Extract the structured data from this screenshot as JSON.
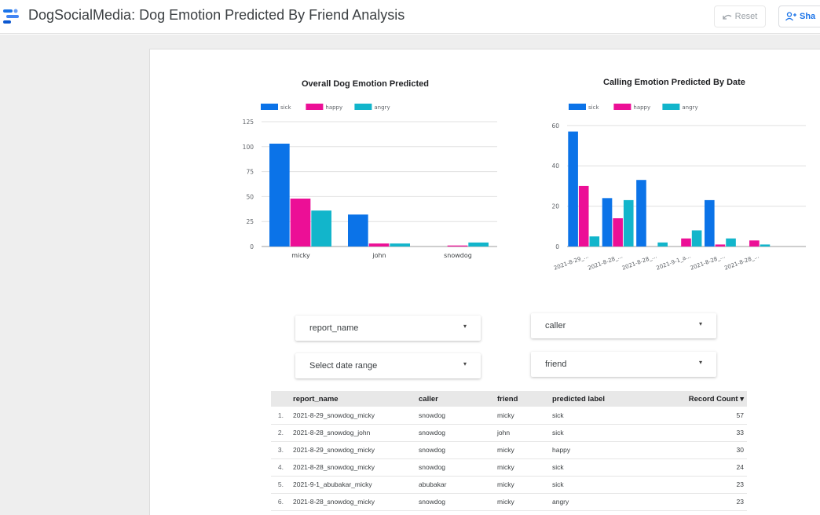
{
  "header": {
    "title": "DogSocialMedia: Dog Emotion Predicted By Friend Analysis",
    "reset_label": "Reset",
    "share_label": "Sha",
    "logo_icon": "looker-studio-logo-icon",
    "reset_icon": "reset-arrow-icon",
    "share_icon": "add-person-icon"
  },
  "colors": {
    "sick": "#0b73e8",
    "happy": "#ec0f96",
    "angry": "#12b5cb",
    "accent": "#1a73e8"
  },
  "chart_data": [
    {
      "type": "bar",
      "title": "Overall Dog Emotion Predicted",
      "categories": [
        "micky",
        "john",
        "snowdog"
      ],
      "series": [
        {
          "name": "sick",
          "values": [
            103,
            32,
            0
          ]
        },
        {
          "name": "happy",
          "values": [
            48,
            3,
            1
          ]
        },
        {
          "name": "angry",
          "values": [
            36,
            3,
            4
          ]
        }
      ],
      "yticks": [
        "0",
        "25",
        "50",
        "75",
        "100",
        "125"
      ],
      "ylim": [
        0,
        125
      ],
      "legend": "top-left",
      "grid": true
    },
    {
      "type": "bar",
      "title": "Calling Emotion Predicted By Date",
      "categories": [
        "2021-8-29_...",
        "2021-8-28_...",
        "2021-8-28_...",
        "2021-9-1_a...",
        "2021-8-28_...",
        "2021-8-28_..."
      ],
      "series": [
        {
          "name": "sick",
          "values": [
            57,
            24,
            33,
            0,
            23,
            0,
            0
          ]
        },
        {
          "name": "happy",
          "values": [
            30,
            14,
            0,
            4,
            1,
            3,
            0
          ]
        },
        {
          "name": "angry",
          "values": [
            5,
            23,
            2,
            8,
            4,
            1,
            0
          ]
        }
      ],
      "yticks": [
        "0",
        "20",
        "40",
        "60"
      ],
      "ylim": [
        0,
        65
      ],
      "legend": "top-left",
      "grid": true
    }
  ],
  "filters": {
    "report_name": "report_name",
    "caller": "caller",
    "date_range": "Select date range",
    "friend": "friend",
    "dropdown_icon": "caret-down-icon"
  },
  "table": {
    "headers": [
      "report_name",
      "caller",
      "friend",
      "predicted label",
      "Record Count"
    ],
    "sort_indicator": "▾",
    "rows": [
      {
        "idx": "1.",
        "report_name": "2021-8-29_snowdog_micky",
        "caller": "snowdog",
        "friend": "micky",
        "label": "sick",
        "count": "57"
      },
      {
        "idx": "2.",
        "report_name": "2021-8-28_snowdog_john",
        "caller": "snowdog",
        "friend": "john",
        "label": "sick",
        "count": "33"
      },
      {
        "idx": "3.",
        "report_name": "2021-8-29_snowdog_micky",
        "caller": "snowdog",
        "friend": "micky",
        "label": "happy",
        "count": "30"
      },
      {
        "idx": "4.",
        "report_name": "2021-8-28_snowdog_micky",
        "caller": "snowdog",
        "friend": "micky",
        "label": "sick",
        "count": "24"
      },
      {
        "idx": "5.",
        "report_name": "2021-9-1_abubakar_micky",
        "caller": "abubakar",
        "friend": "micky",
        "label": "sick",
        "count": "23"
      },
      {
        "idx": "6.",
        "report_name": "2021-8-28_snowdog_micky",
        "caller": "snowdog",
        "friend": "micky",
        "label": "angry",
        "count": "23"
      }
    ]
  }
}
